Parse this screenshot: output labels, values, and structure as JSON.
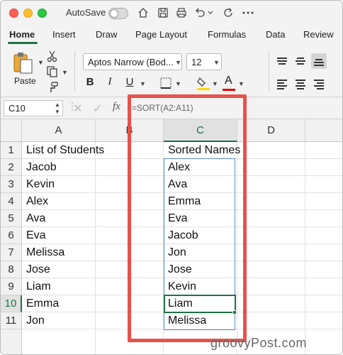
{
  "titlebar": {
    "autosave_label": "AutoSave"
  },
  "tabs": [
    "Home",
    "Insert",
    "Draw",
    "Page Layout",
    "Formulas",
    "Data",
    "Review"
  ],
  "ribbon": {
    "paste_label": "Paste",
    "font_name": "Aptos Narrow (Bod...",
    "font_size": "12",
    "bold": "B",
    "italic": "I",
    "underline": "U",
    "font_color_letter": "A",
    "fill_color": "#ffd700",
    "font_color": "#e00000"
  },
  "formula_bar": {
    "name_box": "C10",
    "fx": "fx",
    "formula": "=SORT(A2:A11)"
  },
  "columns": [
    "A",
    "B",
    "C",
    "D"
  ],
  "rows": [
    "1",
    "2",
    "3",
    "4",
    "5",
    "6",
    "7",
    "8",
    "9",
    "10",
    "11",
    ""
  ],
  "cells": {
    "A": [
      "List of Students",
      "Jacob",
      "Kevin",
      "Alex",
      "Ava",
      "Eva",
      "Melissa",
      "Jose",
      "Liam",
      "Emma",
      "Jon"
    ],
    "C": [
      "Sorted Names",
      "Alex",
      "Ava",
      "Emma",
      "Eva",
      "Jacob",
      "Jon",
      "Jose",
      "Kevin",
      "Liam",
      "Melissa"
    ]
  },
  "accent_color": "#1e7145",
  "highlight_color": "#e8514a",
  "watermark": "groovyPost.com"
}
